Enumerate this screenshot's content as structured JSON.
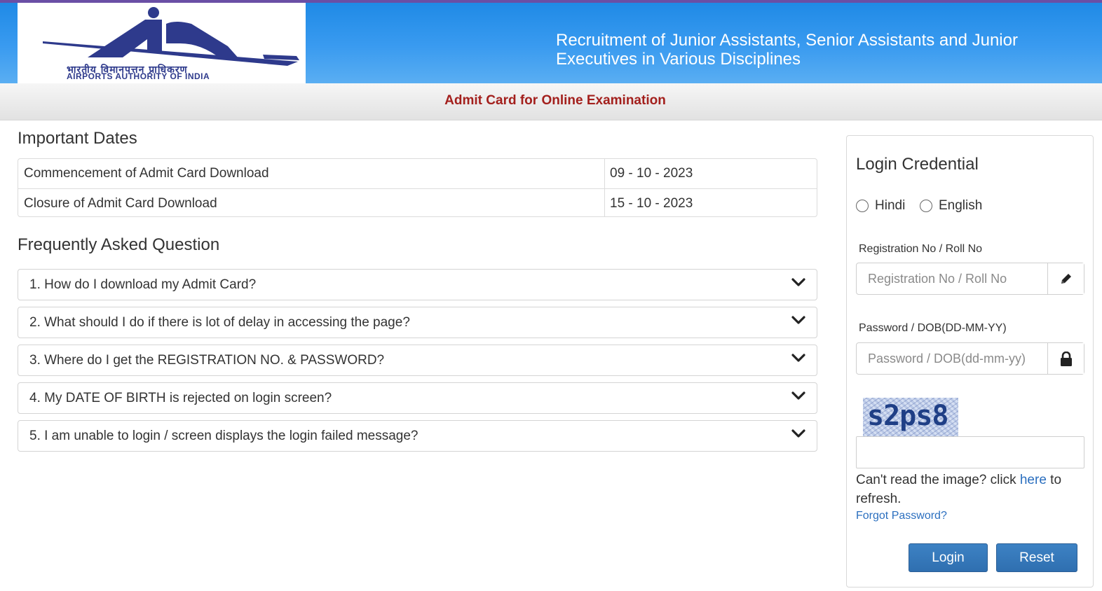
{
  "header": {
    "logo_hindi": "भारतीय विमानपत्तन प्राधिकरण",
    "logo_english": "AIRPORTS AUTHORITY OF INDIA",
    "title": "Recruitment of Junior Assistants, Senior Assistants and Junior Executives in Various Disciplines"
  },
  "subbar": {
    "title": "Admit Card for Online Examination"
  },
  "important_dates": {
    "heading": "Important Dates",
    "rows": [
      {
        "label": "Commencement of Admit Card Download",
        "value": "09 - 10 - 2023"
      },
      {
        "label": "Closure of Admit Card Download",
        "value": "15 - 10 - 2023"
      }
    ]
  },
  "faq": {
    "heading": "Frequently Asked Question",
    "items": [
      "1. How do I download my Admit Card?",
      "2. What should I do if there is lot of delay in accessing the page?",
      "3. Where do I get the REGISTRATION NO. & PASSWORD?",
      "4. My DATE OF BIRTH is rejected on login screen?",
      "5. I am unable to login / screen displays the login failed message?"
    ]
  },
  "login": {
    "title": "Login Credential",
    "languages": [
      "Hindi",
      "English"
    ],
    "registration_label": "Registration No / Roll No",
    "registration_placeholder": "Registration No / Roll No",
    "registration_value": "",
    "password_label": "Password / DOB(DD-MM-YY)",
    "password_placeholder": "Password / DOB(dd-mm-yy)",
    "password_value": "",
    "captcha_text": "s2ps8",
    "captcha_value": "",
    "captcha_note_prefix": "Can't read the image? click ",
    "captcha_note_link": "here",
    "captcha_note_suffix": " to refresh.",
    "forgot_password": "Forgot Password?",
    "login_button": "Login",
    "reset_button": "Reset"
  },
  "icons": {
    "registration_addon": "pencil-icon",
    "password_addon": "lock-icon",
    "faq_toggle": "chevron-down-icon"
  },
  "colors": {
    "header_blue": "#2a90ea",
    "subbar_title": "#a3201d",
    "button_blue": "#3478ba",
    "link_blue": "#2b6fbf",
    "logo_navy": "#2e3a8c"
  }
}
